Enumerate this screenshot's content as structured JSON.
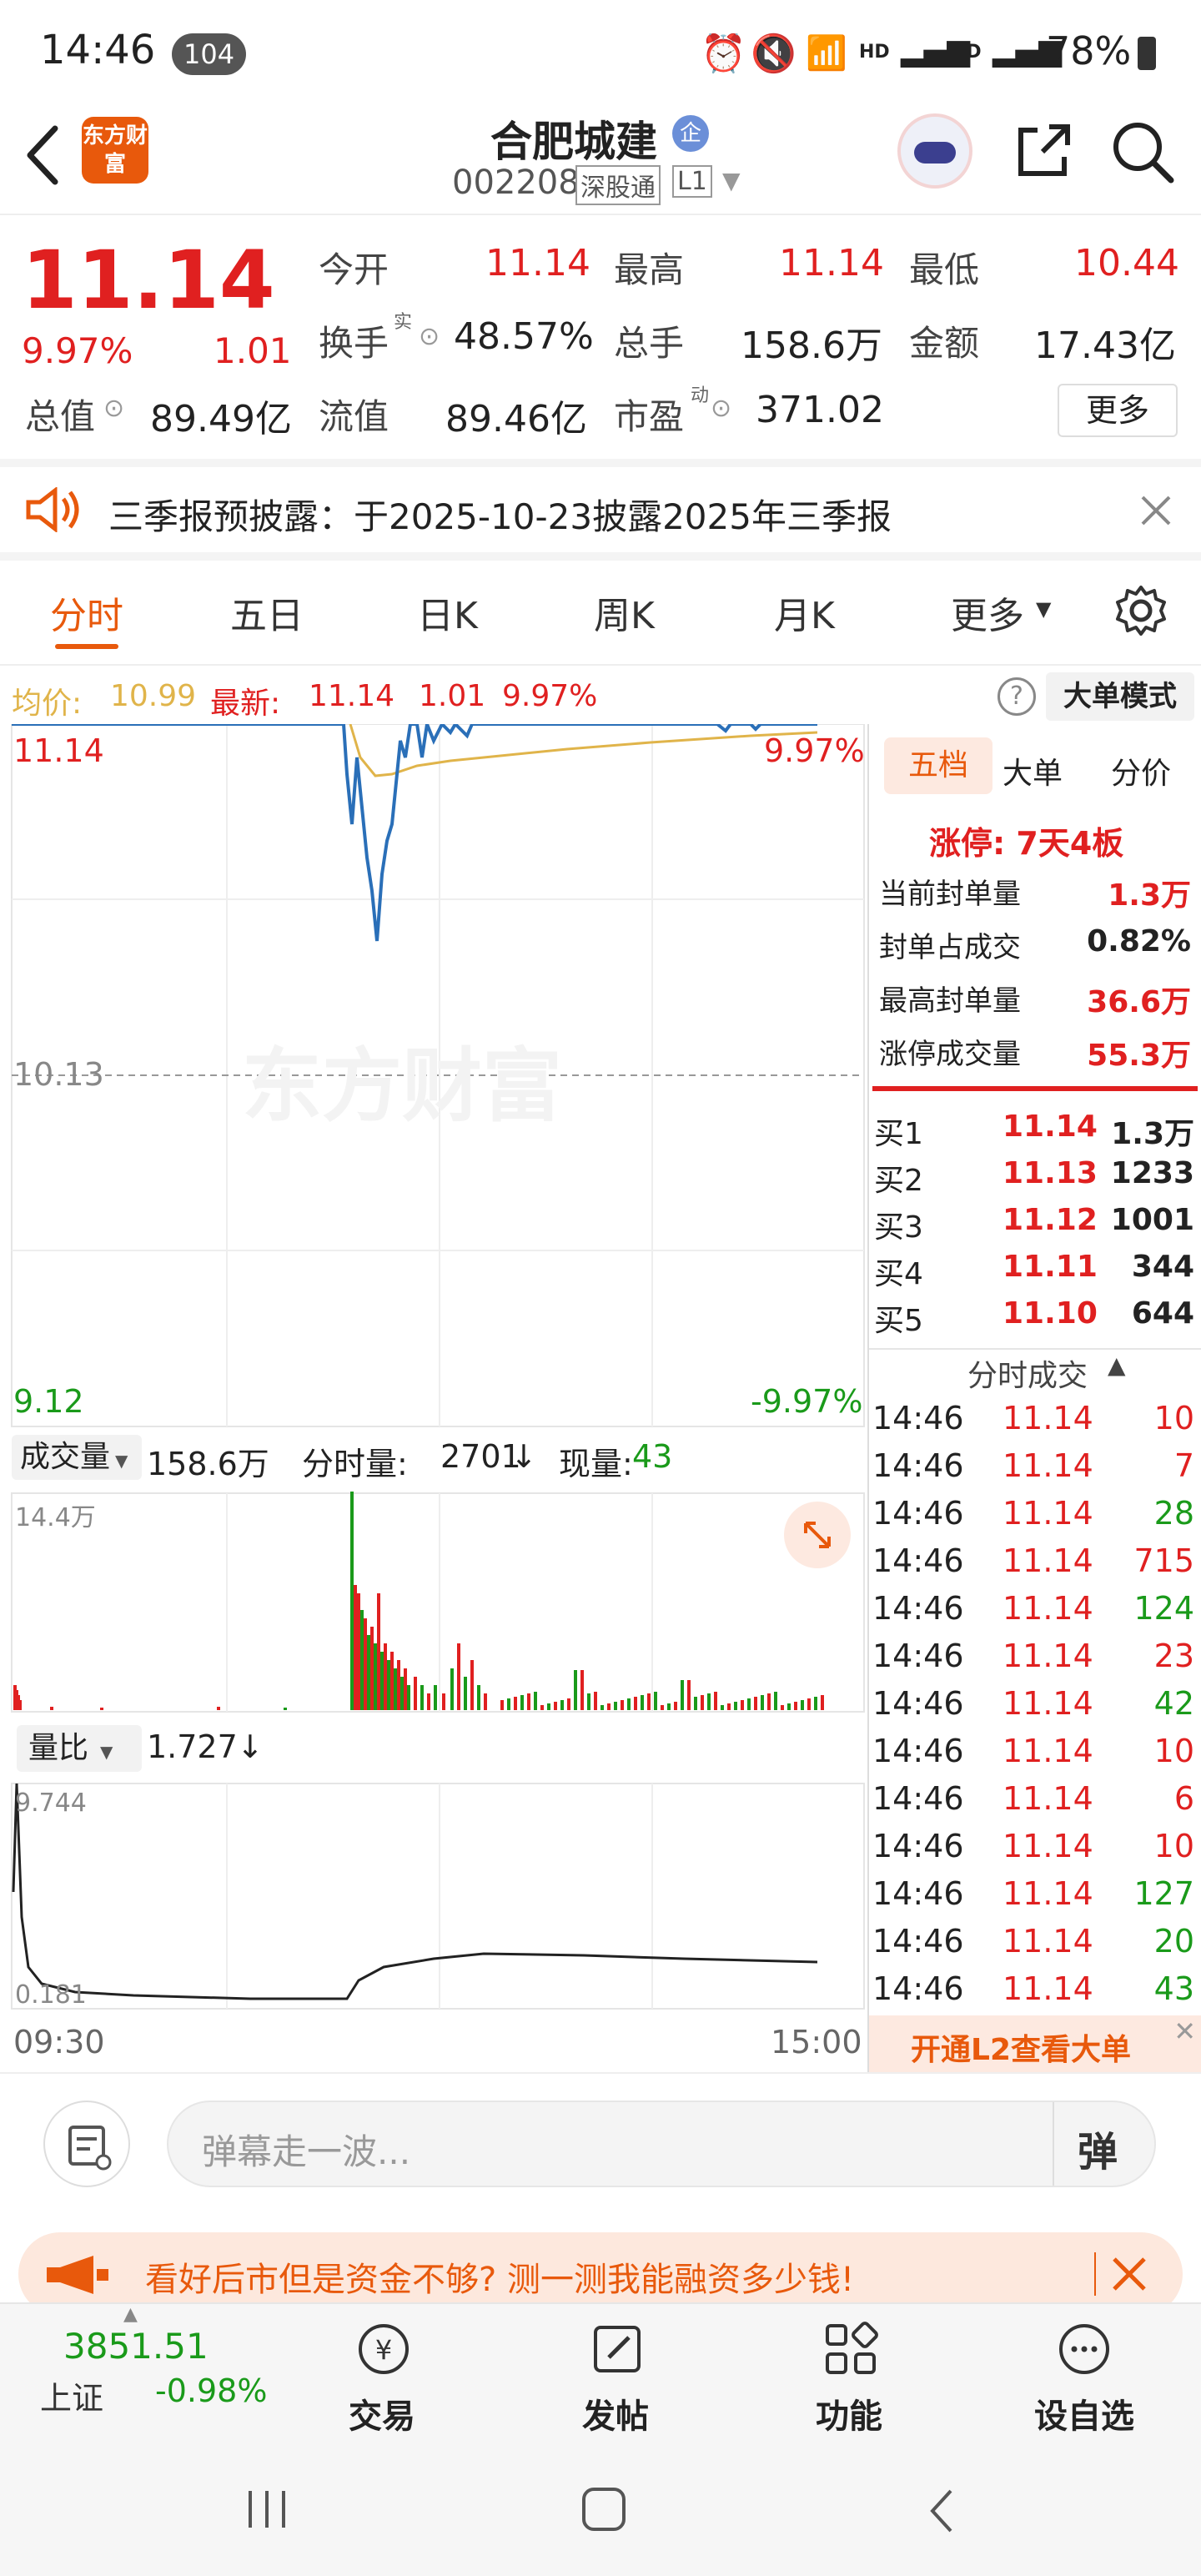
{
  "status": {
    "time": "14:46",
    "notif_count": "104",
    "hd1": "HD",
    "hd2": "HD",
    "battery": "78%"
  },
  "header": {
    "logo_text": "东方财富",
    "name": "合肥城建",
    "badge": "企",
    "code": "002208",
    "tag1": "深股通",
    "tag2": "L1"
  },
  "quote": {
    "price": "11.14",
    "pct": "9.97%",
    "chg": "1.01",
    "open_label": "今开",
    "open": "11.14",
    "high_label": "最高",
    "high": "11.14",
    "low_label": "最低",
    "low": "10.44",
    "turnover_label": "换手",
    "turnover_sup": "实",
    "turnover": "48.57%",
    "volume_label": "总手",
    "volume": "158.6万",
    "amount_label": "金额",
    "amount": "17.43亿",
    "mktcap_label": "总值",
    "mktcap": "89.49亿",
    "float_label": "流值",
    "float": "89.46亿",
    "pe_label": "市盈",
    "pe_sup": "动",
    "pe": "371.02",
    "more": "更多"
  },
  "notice": {
    "text": "三季报预披露：于2025-10-23披露2025年三季报"
  },
  "tabs": {
    "t1": "分时",
    "t2": "五日",
    "t3": "日K",
    "t4": "周K",
    "t5": "月K",
    "t6": "更多"
  },
  "info": {
    "avg_label": "均价:",
    "avg": "10.99",
    "latest_label": "最新:",
    "latest": "11.14",
    "chg": "1.01",
    "pct": "9.97%",
    "mode_btn": "大单模式"
  },
  "chart": {
    "price_top": "11.14",
    "pct_top": "9.97%",
    "price_mid": "10.13",
    "price_bot": "9.12",
    "pct_bot": "-9.97%",
    "watermark": "东方财富",
    "vol_label": "成交量",
    "vol_total": "158.6万",
    "min_vol_label": "分时量:",
    "min_vol": "2701",
    "now_label": "现量:",
    "now": "43",
    "vol_max": "14.4万",
    "ratio_label": "量比",
    "ratio": "1.727",
    "ratio_max": "9.744",
    "ratio_min": "0.181",
    "t_start": "09:30",
    "t_end": "15:00"
  },
  "side": {
    "tabs": [
      "五档",
      "大单",
      "分价"
    ],
    "limit_text": "涨停: 7天4板",
    "stats": [
      {
        "label": "当前封单量",
        "value": "1.3万"
      },
      {
        "label": "封单占成交",
        "value": "0.82%"
      },
      {
        "label": "最高封单量",
        "value": "36.6万"
      },
      {
        "label": "涨停成交量",
        "value": "55.3万"
      }
    ],
    "book": [
      {
        "label": "买1",
        "price": "11.14",
        "qty": "1.3万"
      },
      {
        "label": "买2",
        "price": "11.13",
        "qty": "1233"
      },
      {
        "label": "买3",
        "price": "11.12",
        "qty": "1001"
      },
      {
        "label": "买4",
        "price": "11.11",
        "qty": "344"
      },
      {
        "label": "买5",
        "price": "11.10",
        "qty": "644"
      }
    ],
    "ticks_title": "分时成交",
    "ticks": [
      {
        "t": "14:46",
        "p": "11.14",
        "v": "10",
        "c": "red"
      },
      {
        "t": "14:46",
        "p": "11.14",
        "v": "7",
        "c": "red"
      },
      {
        "t": "14:46",
        "p": "11.14",
        "v": "28",
        "c": "green"
      },
      {
        "t": "14:46",
        "p": "11.14",
        "v": "715",
        "c": "red"
      },
      {
        "t": "14:46",
        "p": "11.14",
        "v": "124",
        "c": "green"
      },
      {
        "t": "14:46",
        "p": "11.14",
        "v": "23",
        "c": "red"
      },
      {
        "t": "14:46",
        "p": "11.14",
        "v": "42",
        "c": "green"
      },
      {
        "t": "14:46",
        "p": "11.14",
        "v": "10",
        "c": "red"
      },
      {
        "t": "14:46",
        "p": "11.14",
        "v": "6",
        "c": "red"
      },
      {
        "t": "14:46",
        "p": "11.14",
        "v": "10",
        "c": "red"
      },
      {
        "t": "14:46",
        "p": "11.14",
        "v": "127",
        "c": "green"
      },
      {
        "t": "14:46",
        "p": "11.14",
        "v": "20",
        "c": "green"
      },
      {
        "t": "14:46",
        "p": "11.14",
        "v": "43",
        "c": "green"
      }
    ],
    "l2_banner": "开通L2查看大单"
  },
  "danmu": {
    "placeholder": "弹幕走一波...",
    "send": "弹"
  },
  "ad": {
    "text": "看好后市但是资金不够? 测一测我能融资多少钱!"
  },
  "bottom": {
    "index_val": "3851.51",
    "index_name": "上证",
    "index_pct": "-0.98%",
    "trade": "交易",
    "post": "发帖",
    "func": "功能",
    "fav": "设自选"
  },
  "colors": {
    "up": "#e02020",
    "down": "#1a9a1a",
    "accent": "#e8590c",
    "line": "#2a6fb8",
    "avg": "#e0b44a"
  }
}
